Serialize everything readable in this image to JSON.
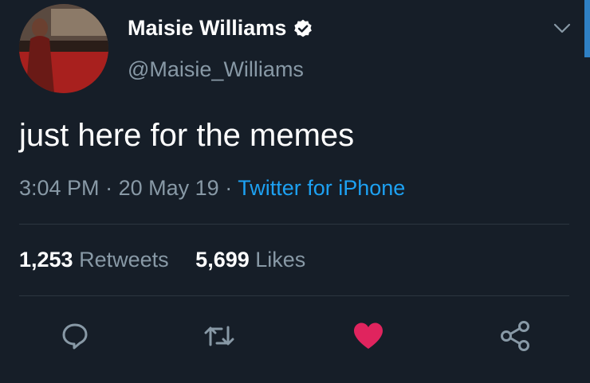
{
  "author": {
    "display_name": "Maisie Williams",
    "handle": "@Maisie_Williams",
    "verified_icon": "verified-badge-icon"
  },
  "tweet": {
    "text": "just here for the memes",
    "time": "3:04 PM",
    "date": "20 May 19",
    "separator": "·",
    "source": "Twitter for iPhone"
  },
  "stats": {
    "retweets_count": "1,253",
    "retweets_label": "Retweets",
    "likes_count": "5,699",
    "likes_label": "Likes"
  },
  "actions": {
    "reply_icon": "reply-icon",
    "retweet_icon": "retweet-icon",
    "like_icon": "heart-icon",
    "share_icon": "share-icon"
  },
  "colors": {
    "background": "#161e28",
    "secondary_text": "#8899a6",
    "link": "#1da1f2",
    "like_active": "#e0245e",
    "icon": "#8899a6"
  }
}
